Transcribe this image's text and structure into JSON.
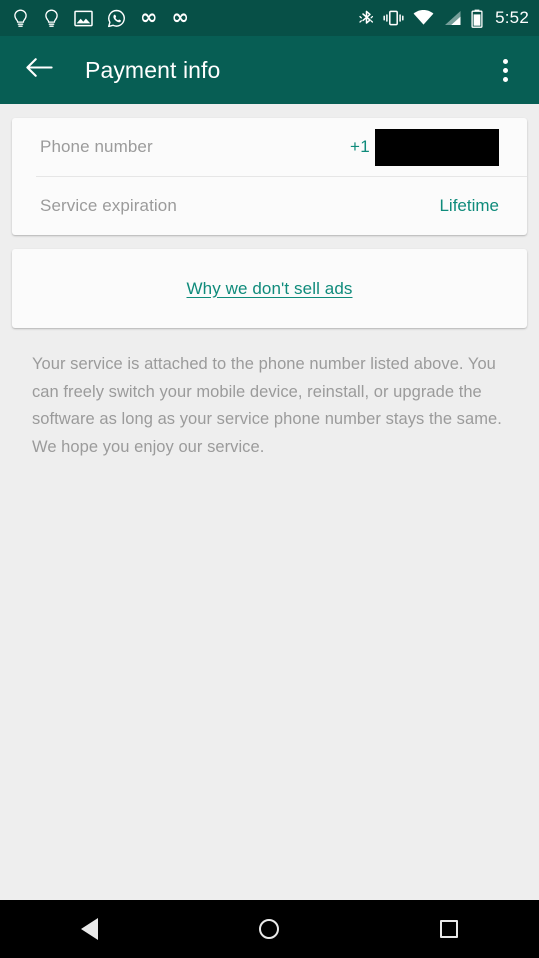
{
  "status_bar": {
    "left_icons": [
      {
        "name": "lightbulb-idea-icon",
        "glyph": "lightbulb"
      },
      {
        "name": "lightbulb-idea-icon-2",
        "glyph": "lightbulb"
      },
      {
        "name": "image-screenshot-icon",
        "glyph": "image"
      },
      {
        "name": "whatsapp-icon",
        "glyph": "whatsapp"
      },
      {
        "name": "infinity-icon",
        "glyph": "∞"
      },
      {
        "name": "infinity-icon-2",
        "glyph": "∞"
      }
    ],
    "right_icons": [
      {
        "name": "bluetooth-icon",
        "glyph": "bluetooth"
      },
      {
        "name": "vibrate-mode-icon",
        "glyph": "vibrate"
      },
      {
        "name": "wifi-icon",
        "glyph": "wifi"
      },
      {
        "name": "cellular-signal-icon",
        "glyph": "signal"
      },
      {
        "name": "battery-icon",
        "glyph": "battery"
      }
    ],
    "time": "5:52"
  },
  "toolbar": {
    "back_icon": "back-arrow-icon",
    "title": "Payment info",
    "overflow_icon": "overflow-menu-icon"
  },
  "info_card": {
    "rows": [
      {
        "label": "Phone number",
        "country_code": "+1",
        "value": "",
        "redacted": true
      },
      {
        "label": "Service expiration",
        "value": "Lifetime",
        "redacted": false
      }
    ]
  },
  "ads_card": {
    "link_label": "Why we don't sell ads"
  },
  "description": "Your service is attached to the phone number listed above. You can freely switch your mobile device, reinstall, or upgrade the software as long as your service phone number stays the same. We hope you enjoy our service.",
  "nav_bar": {
    "back_label": "Back",
    "home_label": "Home",
    "recents_label": "Recents"
  },
  "colors": {
    "status_bar": "#075047",
    "toolbar": "#075e54",
    "accent_teal": "#0f8b7b",
    "page_background": "#eeeeee",
    "card_background": "#fbfbfb",
    "muted_text": "#9b9b9b",
    "nav_bar": "#000000"
  }
}
